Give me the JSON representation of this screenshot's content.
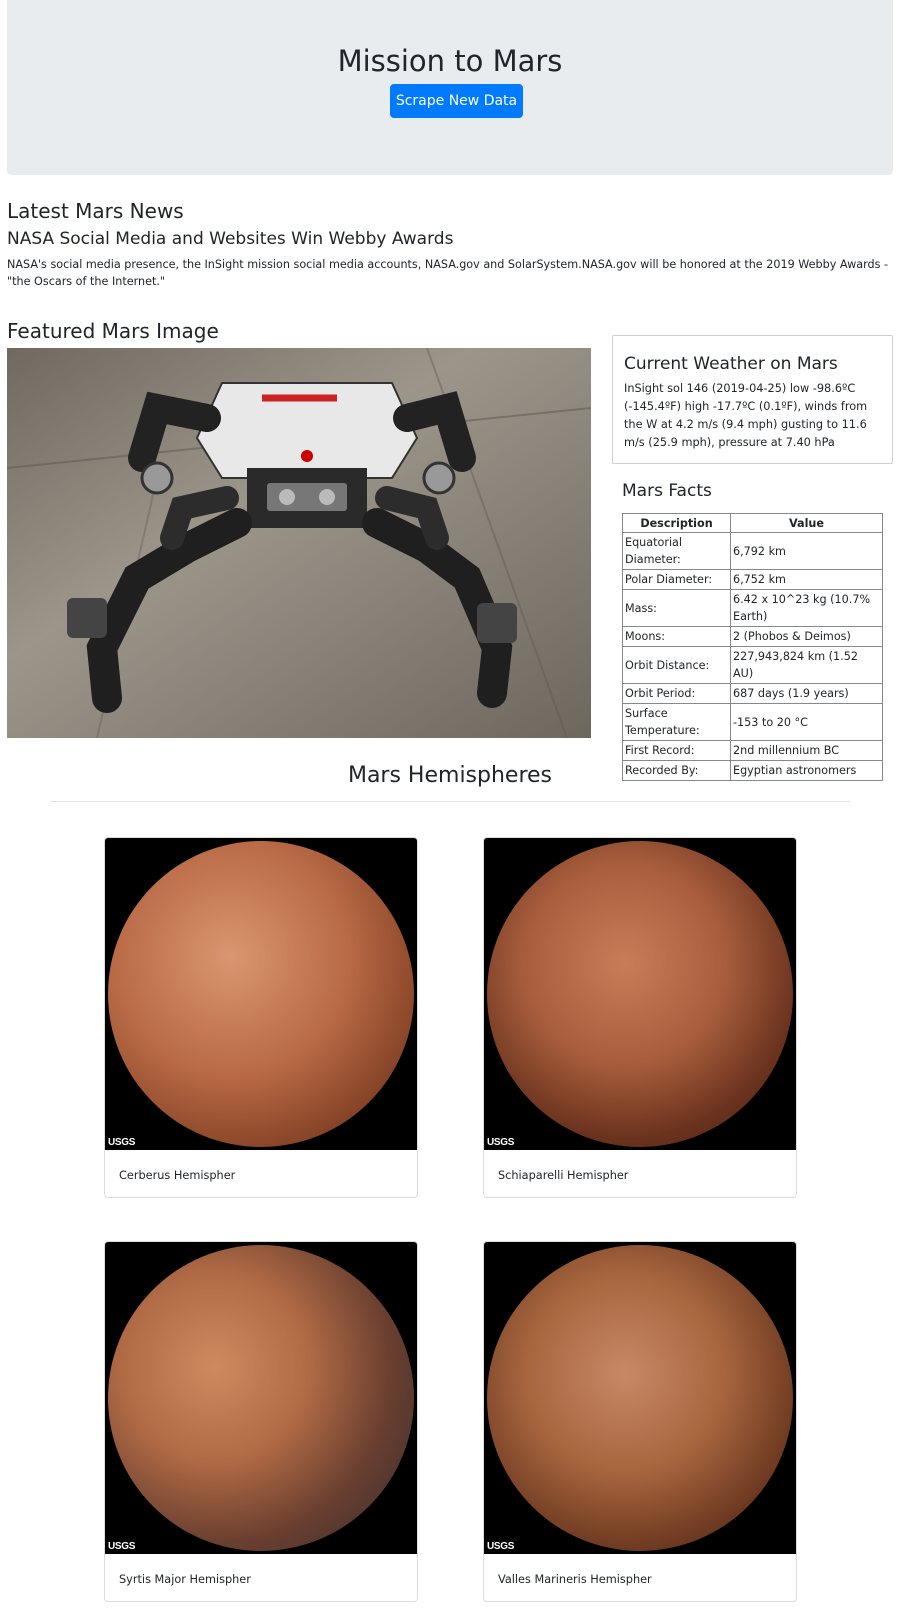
{
  "header": {
    "title": "Mission to Mars",
    "scrape_button": "Scrape New Data"
  },
  "news": {
    "heading": "Latest Mars News",
    "title": "NASA Social Media and Websites Win Webby Awards",
    "body": "NASA's social media presence, the InSight mission social media accounts, NASA.gov and SolarSystem.NASA.gov will be honored at the 2019 Webby Awards - \"the Oscars of the Internet.\""
  },
  "featured": {
    "heading": "Featured Mars Image"
  },
  "weather": {
    "heading": "Current Weather on Mars",
    "text": "InSight sol 146 (2019-04-25) low -98.6ºC (-145.4ºF) high -17.7ºC (0.1ºF), winds from the W at 4.2 m/s (9.4 mph) gusting to 11.6 m/s (25.9 mph), pressure at 7.40 hPa"
  },
  "facts": {
    "heading": "Mars Facts",
    "columns": [
      "Description",
      "Value"
    ],
    "rows": [
      [
        "Equatorial Diameter:",
        "6,792 km"
      ],
      [
        "Polar Diameter:",
        "6,752 km"
      ],
      [
        "Mass:",
        "6.42 x 10^23 kg (10.7% Earth)"
      ],
      [
        "Moons:",
        "2 (Phobos & Deimos)"
      ],
      [
        "Orbit Distance:",
        "227,943,824 km (1.52 AU)"
      ],
      [
        "Orbit Period:",
        "687 days (1.9 years)"
      ],
      [
        "Surface Temperature:",
        "-153 to 20 °C"
      ],
      [
        "First Record:",
        "2nd millennium BC"
      ],
      [
        "Recorded By:",
        "Egyptian astronomers"
      ]
    ]
  },
  "hemispheres": {
    "heading": "Mars Hemispheres",
    "items": [
      {
        "caption": "Cerberus Hemispher",
        "logo": "USGS"
      },
      {
        "caption": "Schiaparelli Hemispher",
        "logo": "USGS"
      },
      {
        "caption": "Syrtis Major Hemispher",
        "logo": "USGS"
      },
      {
        "caption": "Valles Marineris Hemispher",
        "logo": "USGS"
      }
    ]
  }
}
